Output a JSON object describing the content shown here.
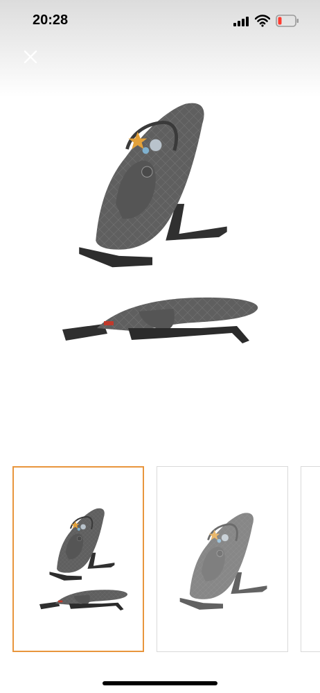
{
  "status_bar": {
    "time": "20:28",
    "signal_icon": "cellular-signal-icon",
    "wifi_icon": "wifi-icon",
    "battery_icon": "battery-low-icon",
    "battery_level": 0.12,
    "battery_color": "#ff3b30"
  },
  "viewer": {
    "close_icon": "close-icon",
    "main_image": "baby-bouncer-two-views",
    "thumbnails": [
      {
        "image": "baby-bouncer-two-views",
        "selected": true
      },
      {
        "image": "baby-bouncer-upright",
        "selected": false
      },
      {
        "image": "partial-thumbnail",
        "selected": false
      }
    ],
    "selected_border_color": "#e8953c"
  }
}
